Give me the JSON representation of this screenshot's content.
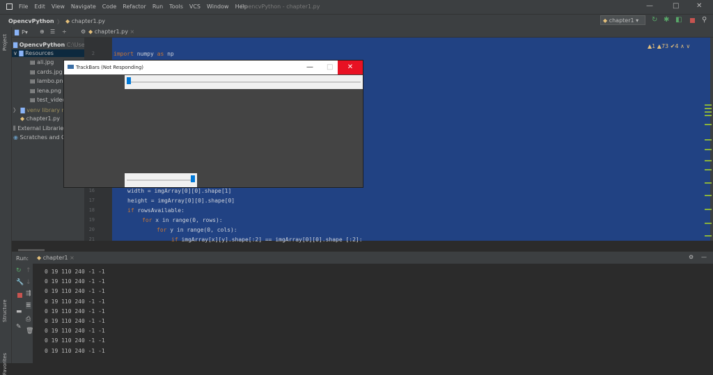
{
  "menubar": {
    "items": [
      "File",
      "Edit",
      "View",
      "Navigate",
      "Code",
      "Refactor",
      "Run",
      "Tools",
      "VCS",
      "Window",
      "Help"
    ],
    "title": "OpencvPython - chapter1.py",
    "minimize": "—",
    "maximize": "□",
    "close": "✕"
  },
  "navbar": {
    "project": "OpencvPython",
    "separator": "〉",
    "file": "chapter1.py",
    "run_config": "chapter1 ▾"
  },
  "toolbar": {
    "project_selector": "P▾",
    "editor_tab": "chapter1.py",
    "tab_close": "×"
  },
  "sidebar": {
    "project_label": "Project",
    "structure_label": "Structure",
    "favorites_label": "Favorites"
  },
  "project_tree": {
    "root": "OpencvPython",
    "root_path": "C:\\Users\\...\\PycharmProjects\\OpencvPython",
    "resources": "Resources",
    "files": [
      "ali.jpg",
      "cards.jpg",
      "lambo.png",
      "lena.png",
      "test_video"
    ],
    "venv": "venv library r",
    "chapter": "chapter1.py",
    "external": "External Libraries",
    "scratches": "Scratches and Co"
  },
  "editor": {
    "inspection": "▲1 ▲73 ✔4 ∧ ∨",
    "top_line_no": "2",
    "top_line": [
      "import",
      " numpy ",
      "as",
      " np"
    ],
    "lines": [
      {
        "no": "16",
        "text": "width = imgArray[0][0].shape[1]"
      },
      {
        "no": "17",
        "text": "height = imgArray[0][0].shape[0]"
      },
      {
        "no": "18",
        "kw": "if",
        "rest": " rowsAvailable:",
        "indent": 0
      },
      {
        "no": "19",
        "kw": "for",
        "rest": " x in range(0, rows):",
        "indent": 1
      },
      {
        "no": "20",
        "kw": "for",
        "rest": " y in range(0, cols):",
        "indent": 2
      },
      {
        "no": "21",
        "kw": "if",
        "rest": " imgArray[x][y].shape[:2] == imgArray[0][0].shape [:2]:",
        "indent": 3
      }
    ]
  },
  "cv_window": {
    "title": "TrackBars (Not Responding)",
    "minimize": "—",
    "maximize": "□",
    "close": "✕",
    "slider_top_value": 0.0,
    "slider_bottom_value": 1.0
  },
  "run": {
    "label": "Run:",
    "tab": "chapter1",
    "tab_close": "×",
    "gear": "⚙",
    "hide": "—",
    "output": [
      "0 19 110 240 -1 -1",
      "0 19 110 240 -1 -1",
      "0 19 110 240 -1 -1",
      "0 19 110 240 -1 -1",
      "0 19 110 240 -1 -1",
      "0 19 110 240 -1 -1",
      "0 19 110 240 -1 -1",
      "0 19 110 240 -1 -1",
      "0 19 110 240 -1 -1"
    ]
  }
}
